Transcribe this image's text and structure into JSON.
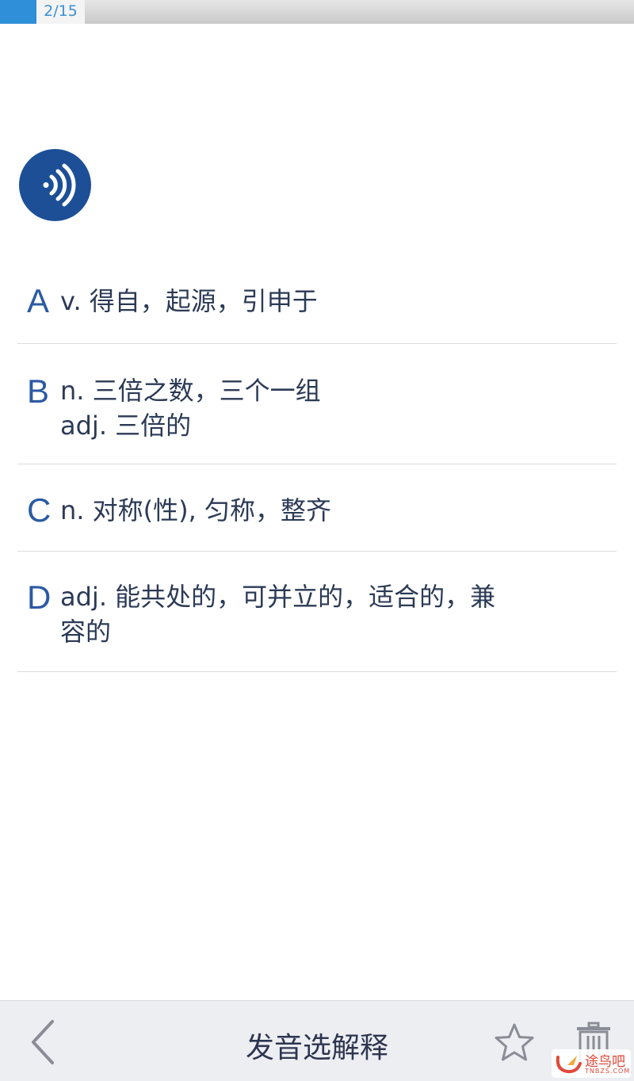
{
  "progress": {
    "label": "2/15",
    "fraction": 0.133,
    "accent": "#2f8fd8"
  },
  "speaker": {
    "icon": "speaker-wave-icon",
    "color": "#1d4f97"
  },
  "options": [
    {
      "letter": "A",
      "lines": [
        "v. 得自，起源，引申于"
      ]
    },
    {
      "letter": "B",
      "lines": [
        "n. 三倍之数，三个一组",
        "adj. 三倍的"
      ]
    },
    {
      "letter": "C",
      "lines": [
        "n. 对称(性), 匀称，整齐"
      ]
    },
    {
      "letter": "D",
      "lines": [
        "adj. 能共处的，可并立的，适合的，兼",
        "容的"
      ]
    }
  ],
  "bottom_bar": {
    "title": "发音选解释",
    "back_icon": "chevron-left-icon",
    "star_icon": "star-outline-icon",
    "trash_icon": "trash-icon"
  },
  "watermark": {
    "text": "途鸟吧",
    "sub": "TNBZS.COM"
  }
}
